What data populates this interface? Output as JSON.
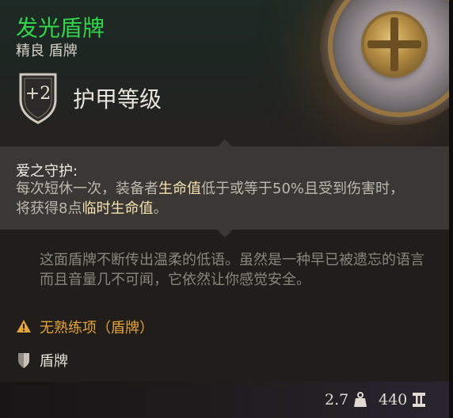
{
  "item": {
    "name": "发光盾牌",
    "rarity_type": "精良 盾牌",
    "armor_class_value": "+2",
    "armor_class_label": "护甲等级"
  },
  "ability": {
    "title": "爱之守护:",
    "desc_1": "每次短休一次，装备者",
    "desc_hl_1": "生命值",
    "desc_2": "低于或等于50%且受到伤害时，将获得8点",
    "desc_hl_2": "临时生命值",
    "desc_3": "。"
  },
  "flavor_text": "这面盾牌不断传出温柔的低语。虽然是一种早已被遗忘的语言而且音量几不可闻，它依然让你感觉安全。",
  "proficiency": {
    "icon": "warning-icon",
    "text": "无熟练项（盾牌）"
  },
  "item_type": {
    "icon": "shield-category-icon",
    "text": "盾牌"
  },
  "footer": {
    "weight": "2.7",
    "weight_icon": "weight-icon",
    "price": "440",
    "price_icon": "gold-coin-icon"
  },
  "colors": {
    "title": "#30d54a",
    "highlight": "#f3e2ae",
    "proficiency_warning": "#e4a43c"
  }
}
